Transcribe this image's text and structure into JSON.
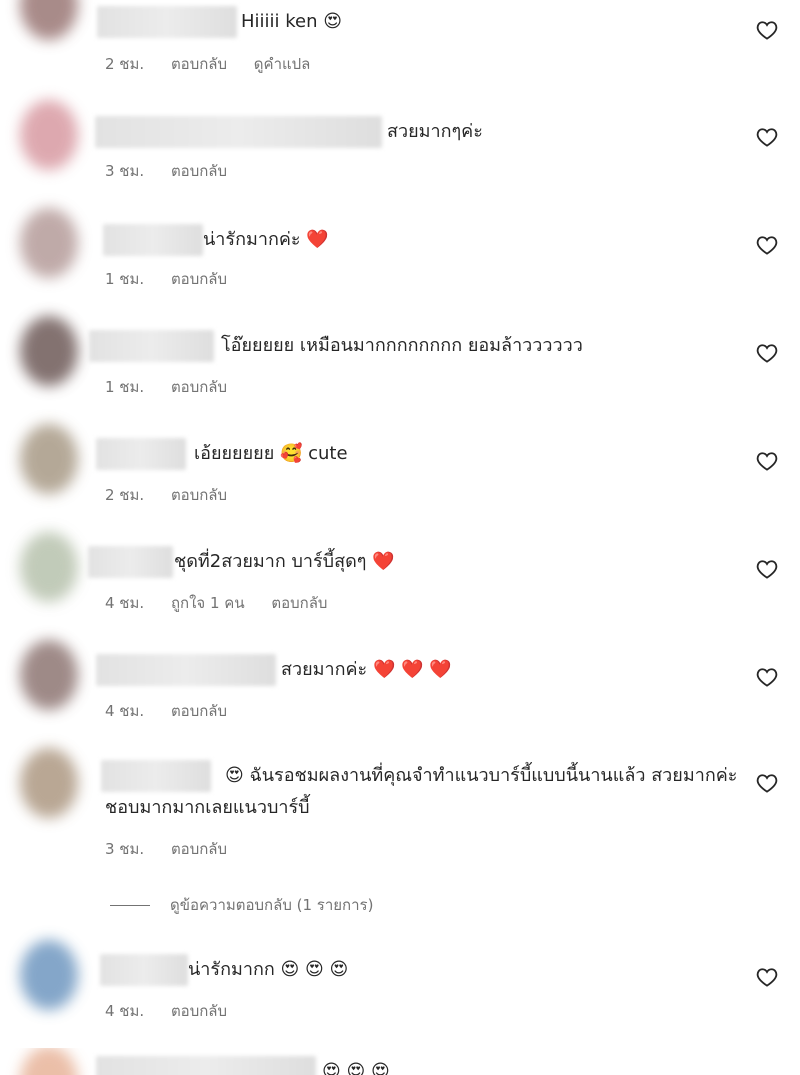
{
  "comments": [
    {
      "text": "Hiiiii ken 😍",
      "time": "2 ชม.",
      "reply": "ตอบกลับ",
      "translate": "ดูคำแปล",
      "likes": ""
    },
    {
      "text": "สวยมากๆค่ะ",
      "time": "3 ชม.",
      "reply": "ตอบกลับ",
      "translate": "",
      "likes": ""
    },
    {
      "text": "น่ารักมากค่ะ ❤️",
      "time": "1 ชม.",
      "reply": "ตอบกลับ",
      "translate": "",
      "likes": ""
    },
    {
      "text": "โอ๊ยยยยย เหมือนมากกกกกกกก ยอมล้าวววววว",
      "time": "1 ชม.",
      "reply": "ตอบกลับ",
      "translate": "",
      "likes": ""
    },
    {
      "text": "เอ้ยยยยยย 🥰 cute",
      "time": "2 ชม.",
      "reply": "ตอบกลับ",
      "translate": "",
      "likes": ""
    },
    {
      "text": "ชุดที่2สวยมาก บาร์บี้สุดๆ ❤️",
      "time": "4 ชม.",
      "reply": "ตอบกลับ",
      "translate": "",
      "likes": "ถูกใจ 1 คน"
    },
    {
      "text": "สวยมากค่ะ ❤️ ❤️ ❤️",
      "time": "4 ชม.",
      "reply": "ตอบกลับ",
      "translate": "",
      "likes": ""
    },
    {
      "text": "😍 ฉันรอชมผลงานที่คุณจำทำแนวบาร์บี้แบบนี้นานแล้ว สวยมากค่ะ ชอบมากมากเลยแนวบาร์บี้",
      "time": "3 ชม.",
      "reply": "ตอบกลับ",
      "translate": "",
      "likes": ""
    },
    {
      "text": "น่ารักมากก 😍 😍 😍",
      "time": "4 ชม.",
      "reply": "ตอบกลับ",
      "translate": "",
      "likes": ""
    }
  ],
  "view_replies": "ดูข้อความตอบกลับ (1 รายการ)",
  "partial_text": "😍 😍 😍",
  "colors": {
    "text": "#262626",
    "meta": "#737373",
    "heart_red": "#ed4956"
  },
  "icons": {
    "like": "heart-outline-icon"
  }
}
